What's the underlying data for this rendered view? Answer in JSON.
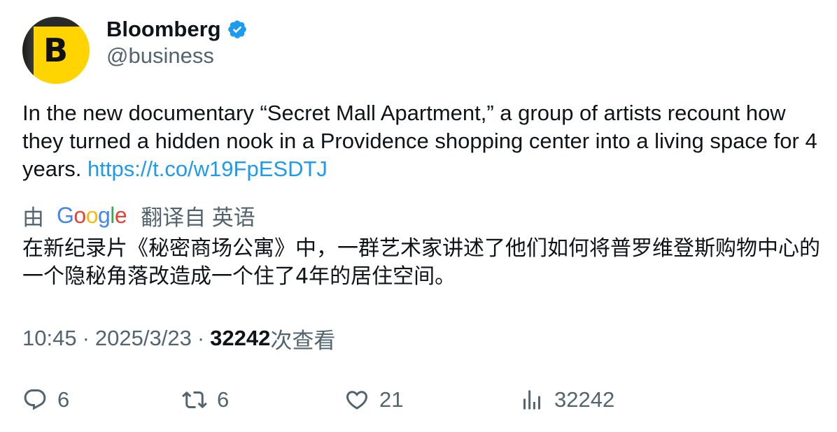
{
  "author": {
    "display_name": "Bloomberg",
    "handle": "@business",
    "avatar_letter": "B",
    "verified": true,
    "avatar_colors": {
      "bg": "#ffd400",
      "dark": "#1a1a1a"
    }
  },
  "tweet": {
    "text": "In the new documentary “Secret Mall Apartment,” a group of artists recount how they turned a hidden nook in a Providence shopping center into a living space for 4 years.",
    "link": "https://t.co/w19FpESDTJ"
  },
  "translation": {
    "by_label": "由",
    "provider": "Google",
    "from_label": "翻译自 英语",
    "text": "在新纪录片《秘密商场公寓》中，一群艺术家讲述了他们如何将普罗维登斯购物中心的一个隐秘角落改造成一个住了4年的居住空间。"
  },
  "meta": {
    "time": "10:45",
    "separator": "·",
    "date": "2025/3/23",
    "views_count": "32242",
    "views_label": "次查看"
  },
  "actions": {
    "replies": "6",
    "retweets": "6",
    "likes": "21",
    "views": "32242"
  },
  "colors": {
    "text": "#0f1419",
    "secondary": "#536471",
    "link": "#1d9bf0",
    "verified": "#1d9bf0"
  }
}
